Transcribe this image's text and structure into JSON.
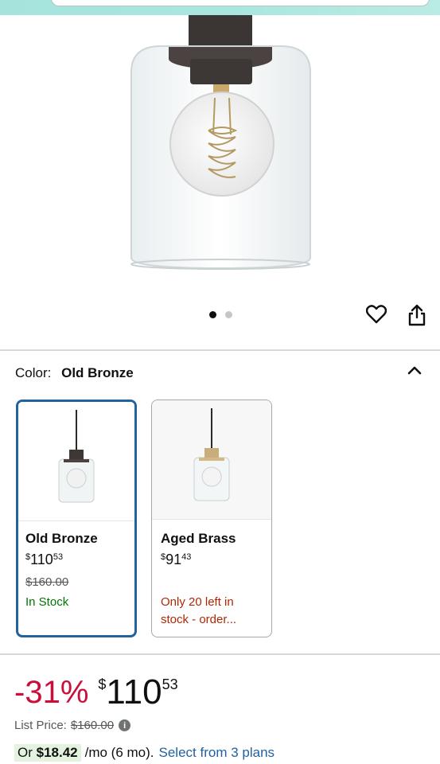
{
  "header": {
    "search_hint": ""
  },
  "product_image": {
    "alt_icon": "pendant-light-image",
    "dots_total": 2,
    "dot_active": 0
  },
  "actions": {
    "wishlist_icon": "heart-icon",
    "share_icon": "share-icon"
  },
  "color_selector": {
    "label": "Color:",
    "selected": "Old Bronze",
    "collapse_icon": "chevron-up-icon",
    "variants": [
      {
        "name": "Old Bronze",
        "currency": "$",
        "whole": "110",
        "cents": "53",
        "list_price": "$160.00",
        "availability": "In Stock",
        "selected": true
      },
      {
        "name": "Aged Brass",
        "currency": "$",
        "whole": "91",
        "cents": "43",
        "availability": "Only 20 left in stock - order...",
        "selected": false
      }
    ]
  },
  "pricing": {
    "discount": "-31%",
    "currency": "$",
    "whole": "110",
    "cents": "53",
    "list_price_label": "List Price:",
    "list_price": "$160.00",
    "info_icon": "i",
    "installment_prefix": "Or ",
    "installment_amount": "$18.42",
    "installment_term": "/mo (6 mo).",
    "installment_link": "Select from 3 plans"
  },
  "colors": {
    "accent_blue": "#2162a1",
    "discount_red": "#cc0c39",
    "stock_green": "#007600",
    "low_stock_red": "#b12704"
  }
}
